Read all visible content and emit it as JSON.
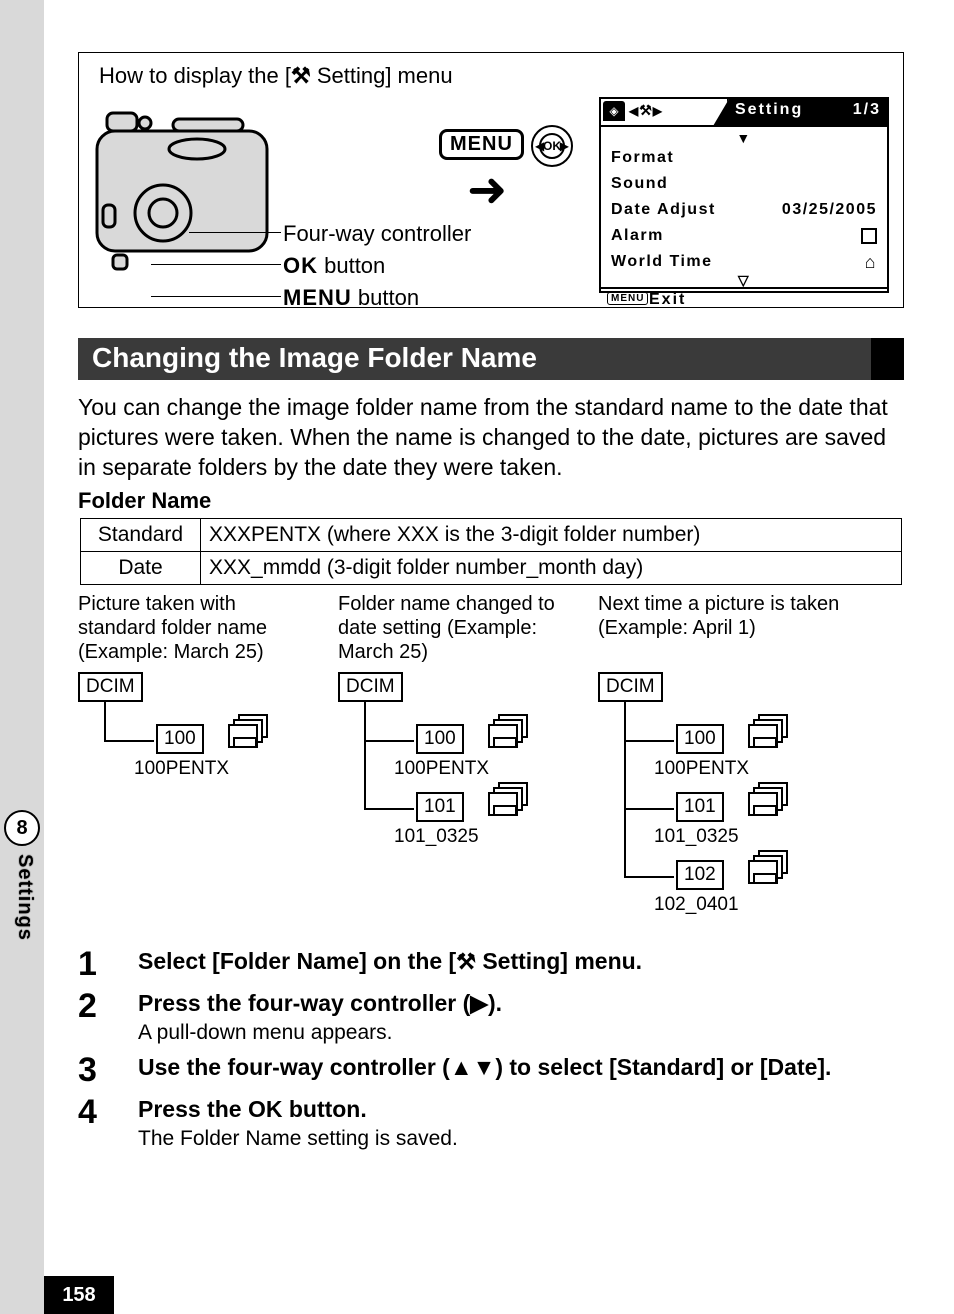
{
  "side": {
    "num": "8",
    "label": "Settings"
  },
  "page_number": "158",
  "howto": {
    "title_pre": "How to display the [",
    "title_post": " Setting] menu",
    "four_way": "Four-way controller",
    "ok_btn": {
      "bold": "OK",
      "rest": " button"
    },
    "menu_btn": {
      "bold": "MENU",
      "rest": " button"
    },
    "menu_label": "MENU",
    "ok_label": "OK"
  },
  "lcd": {
    "tab_word": "Setting",
    "page": "1/3",
    "rows": {
      "format": "Format",
      "sound": "Sound",
      "date_adjust": "Date Adjust",
      "date_value": "03/25/2005",
      "alarm": "Alarm",
      "world_time": "World Time"
    },
    "exit_menu": "MENU",
    "exit_txt": "Exit"
  },
  "heading": "Changing the Image Folder Name",
  "intro": "You can change the image folder name from the standard name to the date that pictures were taken. When the name is changed to the date, pictures are saved in separate folders by the date they were taken.",
  "sub_h": "Folder Name",
  "table": {
    "r1k": "Standard",
    "r1v": "XXXPENTX (where XXX is the 3-digit folder number)",
    "r2k": "Date",
    "r2v": "XXX_mmdd (3-digit folder number_month day)"
  },
  "cols": {
    "c1": {
      "cap": "Picture taken with standard folder name (Example: March 25)",
      "dcim": "DCIM",
      "n100": "100",
      "l100": "100PENTX"
    },
    "c2": {
      "cap": "Folder name changed to date setting (Example: March 25)",
      "dcim": "DCIM",
      "n100": "100",
      "l100": "100PENTX",
      "n101": "101",
      "l101": "101_0325"
    },
    "c3": {
      "cap": "Next time a picture is taken (Example: April 1)",
      "dcim": "DCIM",
      "n100": "100",
      "l100": "100PENTX",
      "n101": "101",
      "l101": "101_0325",
      "n102": "102",
      "l102": "102_0401"
    }
  },
  "steps": {
    "s1": {
      "num": "1",
      "head_pre": "Select [Folder Name] on the [",
      "head_post": " Setting] menu."
    },
    "s2": {
      "num": "2",
      "head": "Press the four-way controller (▶).",
      "desc": "A pull-down menu appears."
    },
    "s3": {
      "num": "3",
      "head": "Use the four-way controller (▲▼) to select [Standard] or [Date]."
    },
    "s4": {
      "num": "4",
      "head_pre": "Press the ",
      "head_ok": "OK",
      "head_post": " button.",
      "desc": "The Folder Name setting is saved."
    }
  },
  "glyphs": {
    "tool": "⚒",
    "tri_r": "▶",
    "tri_l": "◀",
    "tri_d_hollow": "▽",
    "camera": "■",
    "home": "⌂"
  }
}
